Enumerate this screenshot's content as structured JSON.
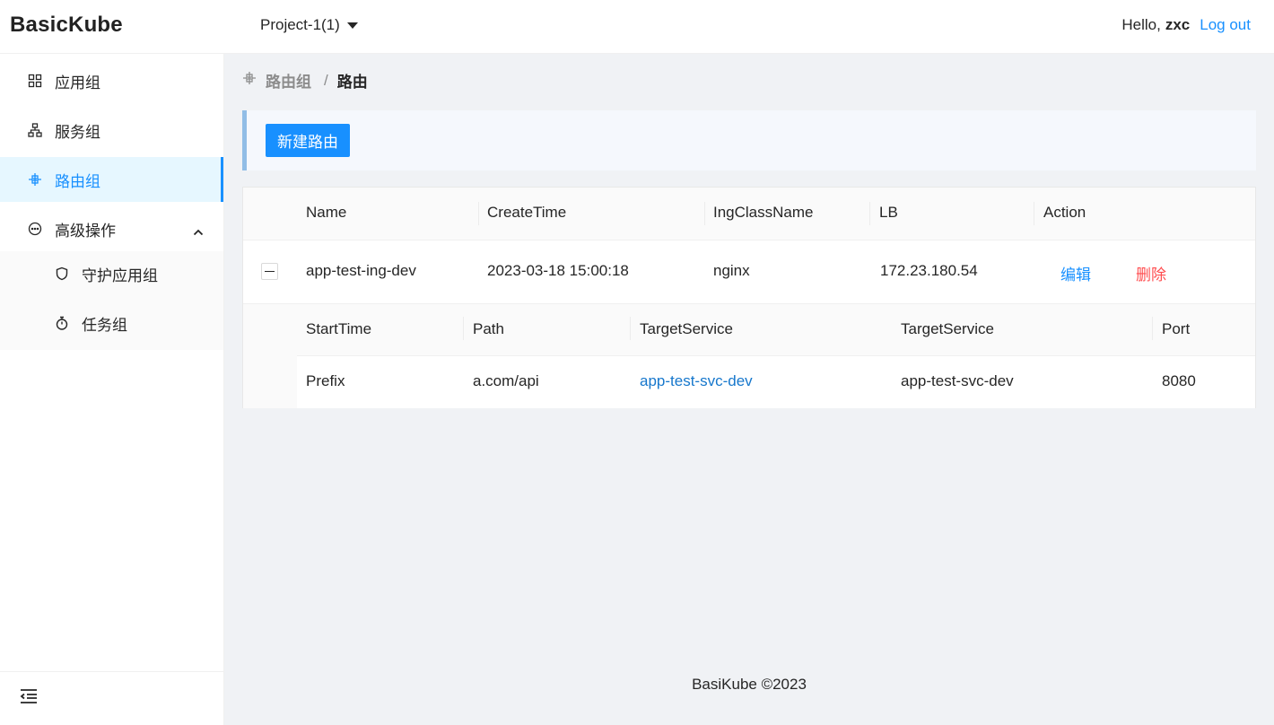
{
  "header": {
    "logo": "BasicKube",
    "project": "Project-1(1)",
    "greeting": "Hello,",
    "user": "zxc",
    "logout": "Log out"
  },
  "sidebar": {
    "items": [
      {
        "label": "应用组",
        "icon": "appstore-icon"
      },
      {
        "label": "服务组",
        "icon": "cluster-icon"
      },
      {
        "label": "路由组",
        "icon": "route-icon",
        "active": true
      },
      {
        "label": "高级操作",
        "icon": "ellipsis-circle-icon",
        "expanded": true
      }
    ],
    "sub_items": [
      {
        "label": "守护应用组",
        "icon": "shield-icon"
      },
      {
        "label": "任务组",
        "icon": "stopwatch-icon"
      }
    ]
  },
  "breadcrumb": {
    "parent": "路由组",
    "separator": "/",
    "current": "路由"
  },
  "toolbar": {
    "new_button": "新建路由"
  },
  "table": {
    "columns": [
      "Name",
      "CreateTime",
      "IngClassName",
      "LB",
      "Action"
    ],
    "rows": [
      {
        "name": "app-test-ing-dev",
        "create_time": "2023-03-18 15:00:18",
        "ing_class": "nginx",
        "lb": "172.23.180.54",
        "edit": "编辑",
        "delete": "删除",
        "sub_columns": [
          "StartTime",
          "Path",
          "TargetService",
          "TargetService",
          "Port"
        ],
        "sub_rows": [
          {
            "start": "Prefix",
            "path": "a.com/api",
            "target_link": "app-test-svc-dev",
            "target": "app-test-svc-dev",
            "port": "8080"
          }
        ]
      }
    ]
  },
  "footer": "BasiKube ©2023",
  "colors": {
    "primary": "#1890ff",
    "danger": "#ff4d4f",
    "active_bg": "#e6f7ff"
  }
}
